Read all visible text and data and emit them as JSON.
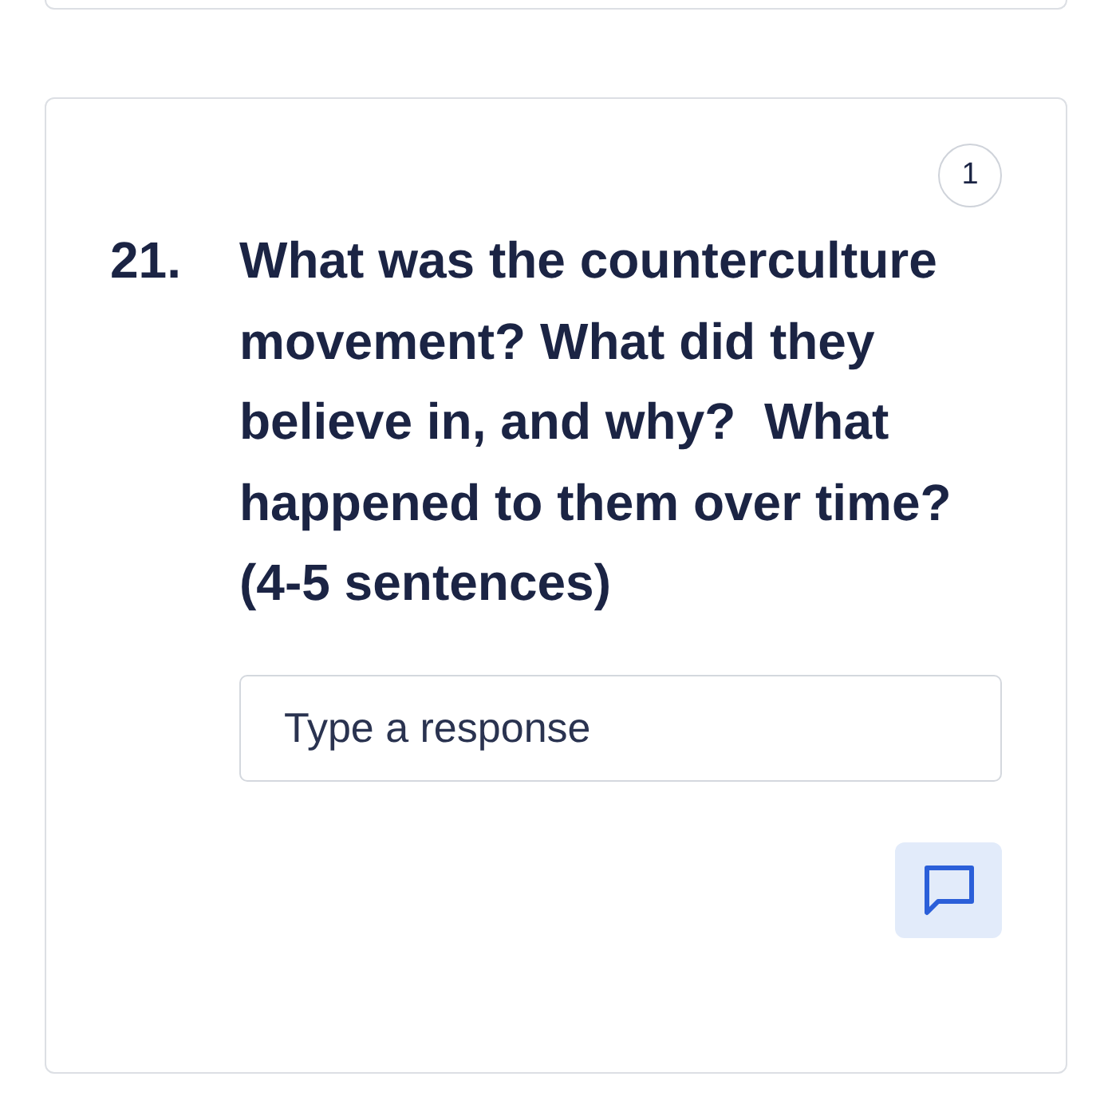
{
  "question": {
    "number": "21.",
    "points": "1",
    "text": "What was the counterculture movement? What did they believe in, and why?  What happened to them over time? (4-5 sentences)"
  },
  "response_field": {
    "placeholder": "Type a response"
  }
}
